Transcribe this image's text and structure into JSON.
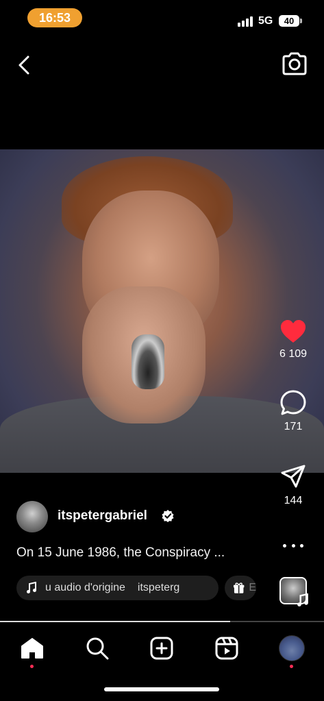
{
  "status_bar": {
    "time": "16:53",
    "network": "5G",
    "battery": "40"
  },
  "top_bar": {
    "back_icon": "chevron-left-icon",
    "camera_icon": "camera-icon"
  },
  "actions": {
    "likes": "6 109",
    "comments": "171",
    "shares": "144",
    "like_color": "#ff2b3d"
  },
  "post": {
    "author": "itspetergabriel",
    "caption": "On 15 June 1986, the Conspiracy ..."
  },
  "chips": {
    "audio_text": "u audio d'origine",
    "audio_author": "itspeterg",
    "gift_text": "E"
  },
  "video_progress": 0.71,
  "nav": {
    "items": [
      "home-icon",
      "search-icon",
      "create-icon",
      "reels-icon",
      "profile-avatar"
    ],
    "active_color": "#ff2d55"
  }
}
